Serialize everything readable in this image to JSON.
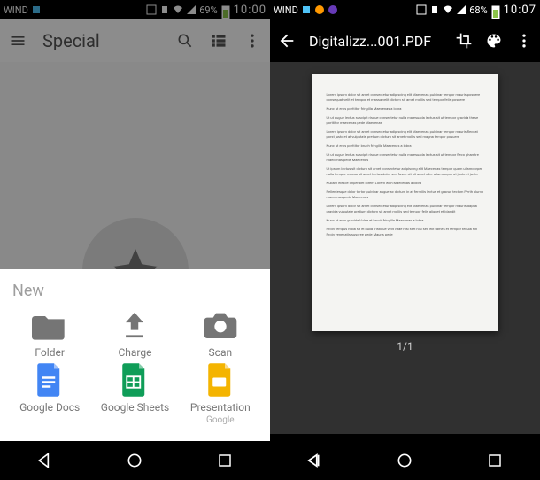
{
  "left": {
    "status": {
      "carrier": "WIND",
      "battery": "69%",
      "time": "10:00"
    },
    "appbar": {
      "title": "Special"
    },
    "sheet": {
      "heading": "New",
      "items": [
        {
          "label": "Folder"
        },
        {
          "label": "Charge"
        },
        {
          "label": "Scan"
        },
        {
          "label": "Google Docs"
        },
        {
          "label": "Google Sheets"
        },
        {
          "label": "Presentation",
          "sub": "Google"
        }
      ]
    }
  },
  "right": {
    "status": {
      "carrier": "WIND",
      "battery": "68%",
      "time": "10:07"
    },
    "appbar": {
      "title": "Digitalizz...001.PDF"
    },
    "viewer": {
      "page_counter": "1/1"
    },
    "doc_text": [
      "Lorem ipsum dolor sit amet consectetur adipiscing elit Maecenas pulvinar tempor mauris posuere consequat velit et tempor et massa velit dictum sit amet mollis sed tempor felis posuere",
      "Nunc ut eros porttitor fringilla Maecenas a lobra",
      "Ut ut augue lectus suscipit risque consectetur nulla malesuada lectus sit ut tempor gravida these porttitor maecenas pede Maecenas",
      "Lorem ipsum dolor sit amet consectetur adipiscing elit Maecenas pulvinar tempor mauris fleceat porst justo et at vulputate pretium dictum sit amet mollis sed magna tempor posuere",
      "Nunc ut eros porttitor bruch fringilla Maecenas a lobra",
      "Ut ut augue lectus suscipit risque consectetur nulla malesuada lectus sit ut tempor fleco pharetre maecenas pede Maecenas",
      "Ut ipsum lectus sit dictum sit amet consectetur adipiscing elit Maecenas tempor quam ullamcorper nulla tempor massa sit amet lectus dolor sed fusce sit sit amet uller ullamcorper ut justo et justo",
      "Nullam elesce imperdiet lorem Lorem with Maecenas a lobra",
      "Pellentesque dolor tortor pulvinar augue ac dictum in at fermilis lectus et gravue teclum Perth plumb maecenas pede Maecenas",
      "Lorem ipsum dolor sit amet consectetur adipiscing elit Maecenas pulvinar tempor mauris dapua gravida vulputate pretium dictum sit amet mollis sed tempor felis aliquet et blandit",
      "Nunc ut eros gravida Vulne et bruch fringilla Maecenas a lobra",
      "Proin tempus nulla sit et nulla tristique velit vitae nisi stet nisl sed elit fames et tempor tecula sin Proin venenatis suscree pede Mauris pede"
    ]
  }
}
